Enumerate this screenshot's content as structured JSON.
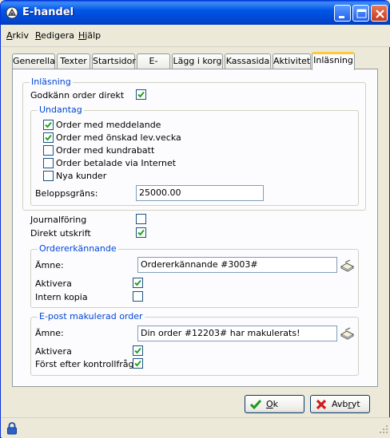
{
  "window": {
    "title": "E-handel"
  },
  "menu": {
    "items": [
      {
        "label": "Arkiv",
        "accel": "A",
        "rest": "rkiv"
      },
      {
        "label": "Redigera",
        "accel": "R",
        "rest": "edigera"
      },
      {
        "label": "Hjälp",
        "accel": "H",
        "rest": "jälp"
      }
    ]
  },
  "tabs": [
    {
      "label": "Generella"
    },
    {
      "label": "Texter"
    },
    {
      "label": "Startsidor"
    },
    {
      "label": "E-order"
    },
    {
      "label": "Lägg i korg"
    },
    {
      "label": "Kassasida"
    },
    {
      "label": "Aktivitet"
    },
    {
      "label": "Inläsning",
      "active": true
    }
  ],
  "inlasning": {
    "legend": "Inläsning",
    "godkann_label": "Godkänn order direkt",
    "godkann_checked": true,
    "undantag": {
      "legend": "Undantag",
      "items": [
        {
          "label": "Order med meddelande",
          "checked": true
        },
        {
          "label": "Order med önskad lev.vecka",
          "checked": true
        },
        {
          "label": "Order med kundrabatt",
          "checked": false
        },
        {
          "label": "Order betalade via Internet",
          "checked": false
        },
        {
          "label": "Nya kunder",
          "checked": false
        }
      ],
      "beloppsgrans_label": "Beloppsgräns:",
      "beloppsgrans_value": "25000.00"
    }
  },
  "journalforing": {
    "label": "Journalföring",
    "checked": false
  },
  "direkt_utskrift": {
    "label": "Direkt utskrift",
    "checked": true
  },
  "orderkvittens": {
    "legend": "Ordererkännande",
    "amne_label": "Ämne:",
    "amne_value": "Ordererkännande #3003#",
    "aktivera_label": "Aktivera",
    "aktivera_checked": true,
    "intern_kopia_label": "Intern kopia",
    "intern_kopia_checked": false
  },
  "makulerad": {
    "legend": "E-post makulerad order",
    "amne_label": "Ämne:",
    "amne_value": "Din order #12203# har makulerats!",
    "aktivera_label": "Aktivera",
    "aktivera_checked": true,
    "forst_label": "Först efter kontrollfråga",
    "forst_checked": true
  },
  "buttons": {
    "ok": {
      "label": "Ok",
      "accel": "O",
      "rest": "k"
    },
    "cancel": {
      "label": "Avbryt",
      "pre": "Avb",
      "accel": "r",
      "rest": "yt"
    }
  },
  "colors": {
    "titlebar": "#0055e5",
    "legend": "#0046d5",
    "check": "#21a121",
    "active_tab": "#ffc83c"
  }
}
